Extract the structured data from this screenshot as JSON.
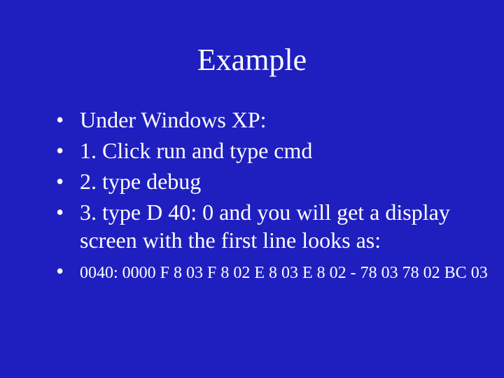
{
  "slide": {
    "title": "Example",
    "bullets": [
      "Under Windows XP:",
      "1. Click run and type cmd",
      "2. type debug",
      "3. type D 40: 0 and you will get a display screen with the first line looks as:"
    ],
    "hex_line": "0040: 0000 F 8 03 F 8 02 E 8 03 E 8 02 - 78 03 78 02 BC 03"
  }
}
